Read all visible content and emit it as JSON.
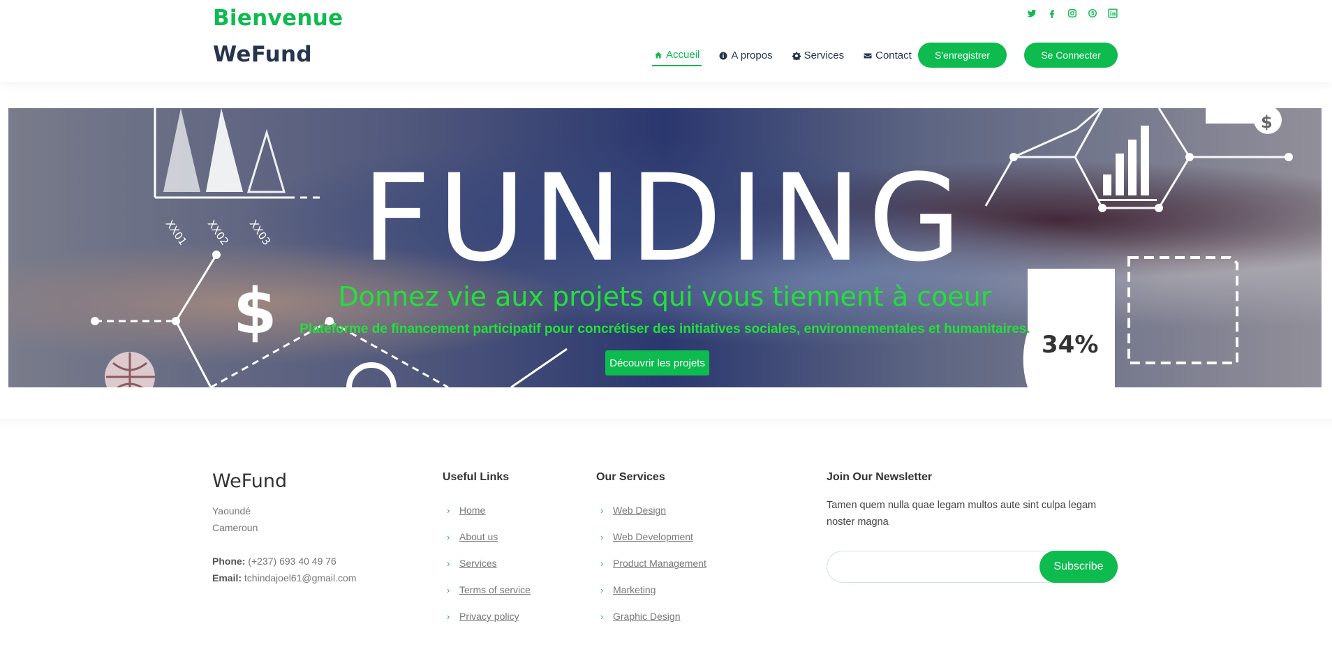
{
  "header": {
    "brand_line1": "Bienvenue",
    "brand_line2": "WeFund",
    "socials": [
      "twitter-icon",
      "facebook-icon",
      "instagram-icon",
      "skype-icon",
      "linkedin-icon"
    ],
    "nav": [
      {
        "label": "Accueil",
        "icon": "home-icon",
        "active": true
      },
      {
        "label": "A propos",
        "icon": "info-icon",
        "active": false
      },
      {
        "label": "Services",
        "icon": "gear-icon",
        "active": false
      },
      {
        "label": "Contact",
        "icon": "envelope-icon",
        "active": false
      }
    ],
    "register_label": "S'enregistrer",
    "login_label": "Se Connecter"
  },
  "hero": {
    "title": "FUNDING",
    "subtitle": "Donnez vie aux projets qui vous tiennent à coeur",
    "description": "Plateforme de financement participatif pour concrétiser des initiatives sociales, environnementales et humanitaires.",
    "button_label": "Découvrir les projets",
    "graphic_labels": [
      "XX01",
      "XX02",
      "XX03",
      "34%"
    ]
  },
  "footer": {
    "brand": "WeFund",
    "address_line1": "Yaoundé",
    "address_line2": "Cameroun",
    "phone_label": "Phone:",
    "phone": "(+237) 693 40 49 76",
    "email_label": "Email:",
    "email": "tchindajoel61@gmail.com",
    "useful_links_title": "Useful Links",
    "useful_links": [
      "Home",
      "About us",
      "Services",
      "Terms of service",
      "Privacy policy"
    ],
    "services_title": "Our Services",
    "services": [
      "Web Design",
      "Web Development",
      "Product Management",
      "Marketing",
      "Graphic Design"
    ],
    "newsletter_title": "Join Our Newsletter",
    "newsletter_text": "Tamen quem nulla quae legam multos aute sint culpa legam noster magna",
    "newsletter_input_value": "",
    "subscribe_label": "Subscribe"
  },
  "colors": {
    "accent": "#0dbb4f",
    "navy": "#25344f",
    "hero_text_green": "#22e03a"
  }
}
